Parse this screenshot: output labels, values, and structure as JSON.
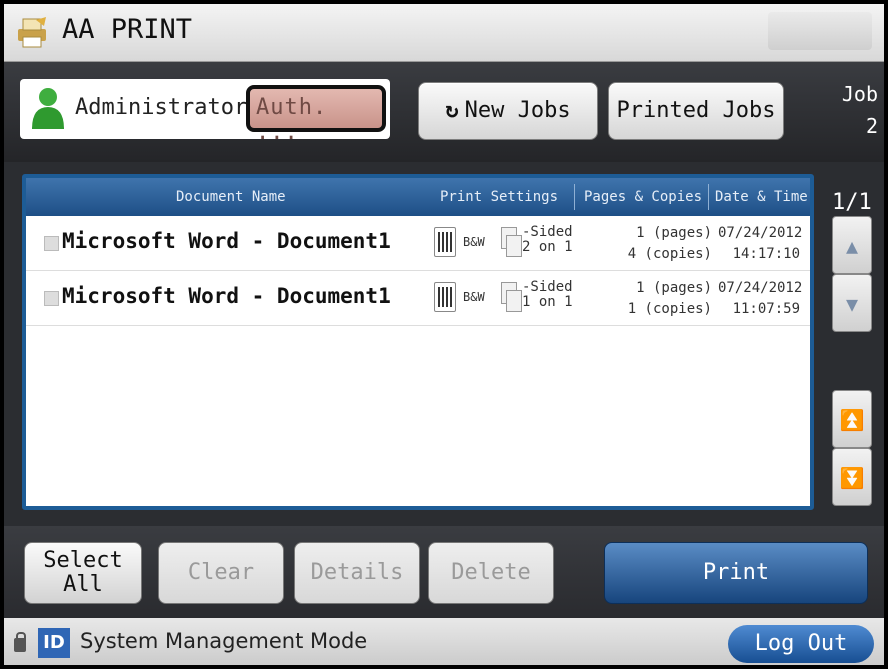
{
  "titlebar": {
    "app_title": "AA PRINT",
    "app_icon": "printer-app-icon"
  },
  "user": {
    "name": "Administrator",
    "auth_label": "Auth. ...",
    "icon": "user-icon"
  },
  "toolbar": {
    "new_jobs_icon": "↻",
    "new_jobs_label": "New Jobs",
    "printed_jobs_label": "Printed Jobs",
    "job_label": "Job",
    "job_count": "2"
  },
  "list": {
    "headers": {
      "doc": "Document Name",
      "settings": "Print Settings",
      "pages_copies": "Pages & Copies",
      "date_time": "Date & Time"
    },
    "rows": [
      {
        "name": "Microsoft Word - Document1",
        "color": "B&W",
        "sided_line1": "-Sided",
        "sided_line2": "2 on 1",
        "pages": "1 (pages)",
        "copies": "4 (copies)",
        "date": "07/24/2012",
        "time": "14:17:10"
      },
      {
        "name": "Microsoft Word - Document1",
        "color": "B&W",
        "sided_line1": "-Sided",
        "sided_line2": "1 on 1",
        "pages": "1 (pages)",
        "copies": "1 (copies)",
        "date": "07/24/2012",
        "time": "11:07:59"
      }
    ]
  },
  "pager": {
    "indicator": "1/1",
    "up": "▲",
    "down": "▼",
    "top": "⏫",
    "bottom": "⏬"
  },
  "actions": {
    "select_all_line1": "Select",
    "select_all_line2": "All",
    "clear": "Clear",
    "details": "Details",
    "delete": "Delete",
    "print": "Print"
  },
  "status": {
    "id_badge": "ID",
    "mode": "System Management Mode",
    "logout": "Log Out"
  },
  "colors": {
    "header_blue": "#1e4f86",
    "print_blue": "#17457d",
    "id_blue": "#2f66b5"
  }
}
